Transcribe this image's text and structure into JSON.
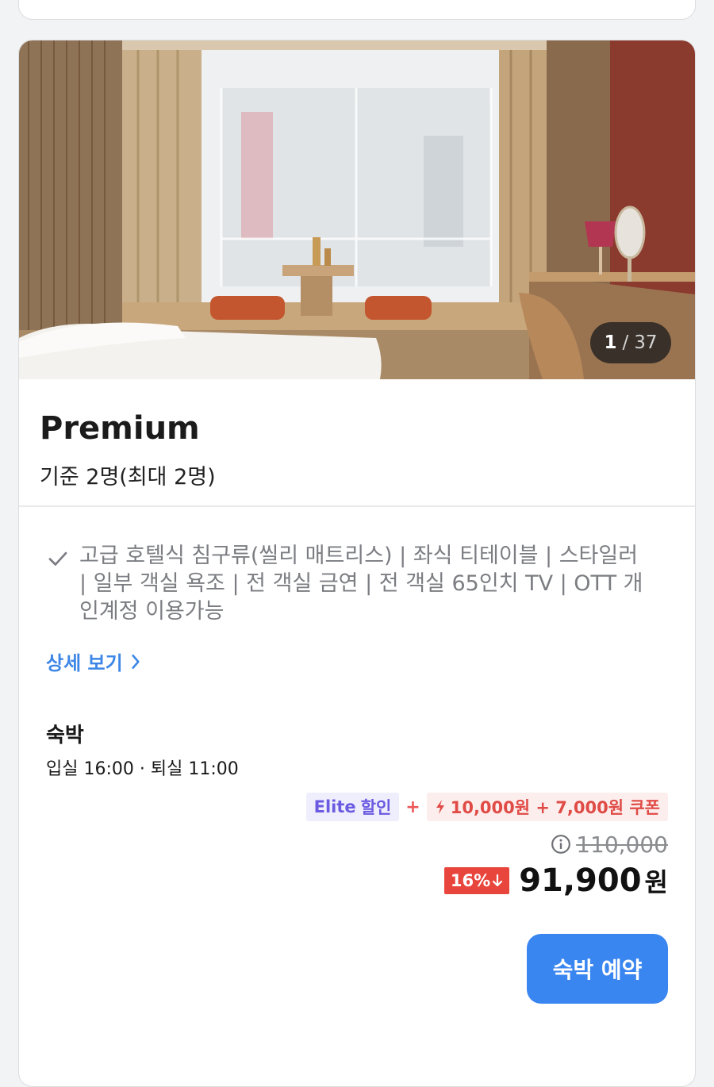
{
  "photo": {
    "counter_current": "1",
    "counter_sep": "/",
    "counter_total": "37"
  },
  "room": {
    "name": "Premium",
    "capacity": "기준 2명(최대 2명)"
  },
  "amenities": {
    "text": "고급 호텔식 침구류(씰리 매트리스) | 좌식 티테이블 | 스타일러 | 일부 객실 욕조 | 전 객실 금연 | 전 객실 65인치 TV | OTT 개인계정 이용가능",
    "icon": "check-icon"
  },
  "detail_link": {
    "label": "상세 보기",
    "icon": "chevron-right-icon"
  },
  "stay": {
    "title": "숙박",
    "times": "입실 16:00 · 퇴실 11:00"
  },
  "promo": {
    "elite_label": "Elite",
    "elite_suffix": "할인",
    "plus": "+",
    "coupon_label": "10,000원 + 7,000원 쿠폰",
    "coupon_icon": "bolt-icon"
  },
  "price": {
    "original": "110,000",
    "discount": "16%",
    "final": "91,900",
    "currency": "원",
    "info_icon": "info-icon"
  },
  "booking": {
    "button_label": "숙박 예약"
  },
  "colors": {
    "accent": "#3a86f1",
    "link": "#3d86e6",
    "discount": "#e8453c",
    "elite": "#6a5be0"
  }
}
